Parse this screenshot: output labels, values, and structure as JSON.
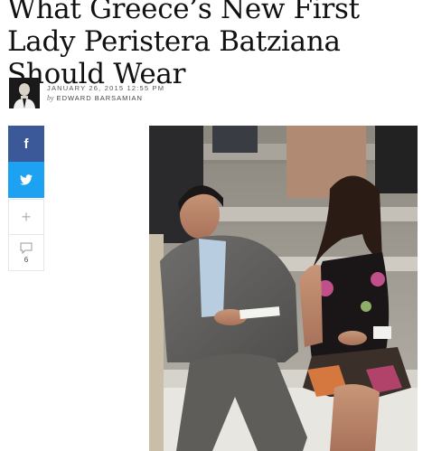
{
  "article": {
    "title": "What Greece’s New First Lady Peristera Batziana Should Wear",
    "date": "JANUARY 26, 2015 12:55 PM",
    "byline_prefix": "by",
    "author": "EDWARD BARSAMIAN"
  },
  "share": {
    "facebook_icon": "facebook-icon",
    "twitter_icon": "twitter-icon",
    "more_icon": "plus-icon",
    "comment_icon": "comment-icon",
    "comment_count": "6",
    "colors": {
      "facebook": "#3b5998",
      "twitter": "#1da1f2"
    }
  },
  "photo": {
    "subject": "photo of a man in a grey suit and a woman in a floral black dress seated on stone steps"
  }
}
